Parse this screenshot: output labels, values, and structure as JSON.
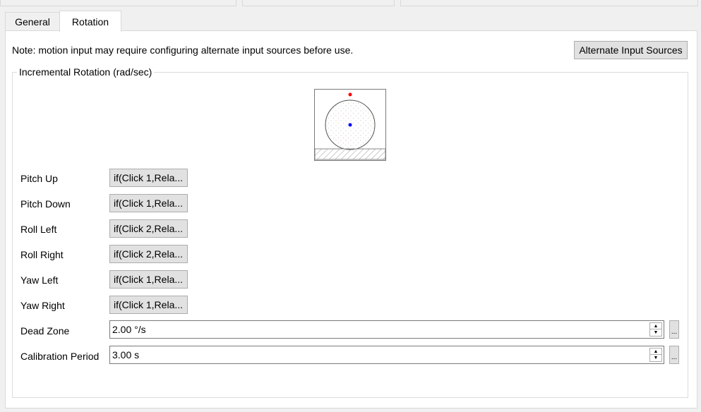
{
  "tabs": [
    {
      "label": "General",
      "active": false
    },
    {
      "label": "Rotation",
      "active": true
    }
  ],
  "note": "Note: motion input may require configuring alternate input sources before use.",
  "alternate_button": "Alternate Input Sources",
  "group": {
    "title": "Incremental Rotation (rad/sec)",
    "bindings": [
      {
        "label": "Pitch Up",
        "value": "if(Click 1,Rela..."
      },
      {
        "label": "Pitch Down",
        "value": "if(Click 1,Rela..."
      },
      {
        "label": "Roll Left",
        "value": "if(Click 2,Rela..."
      },
      {
        "label": "Roll Right",
        "value": "if(Click 2,Rela..."
      },
      {
        "label": "Yaw Left",
        "value": "if(Click 1,Rela..."
      },
      {
        "label": "Yaw Right",
        "value": "if(Click 1,Rela..."
      }
    ],
    "dead_zone": {
      "label": "Dead Zone",
      "value": "2.00 °/s",
      "more": "..."
    },
    "calibration": {
      "label": "Calibration Period",
      "value": "3.00 s",
      "more": "..."
    }
  },
  "colors": {
    "target_dot": "#ff0000",
    "current_dot": "#0000ff"
  },
  "icons": {
    "spin_up": "triangle-up-icon",
    "spin_down": "triangle-down-icon"
  }
}
